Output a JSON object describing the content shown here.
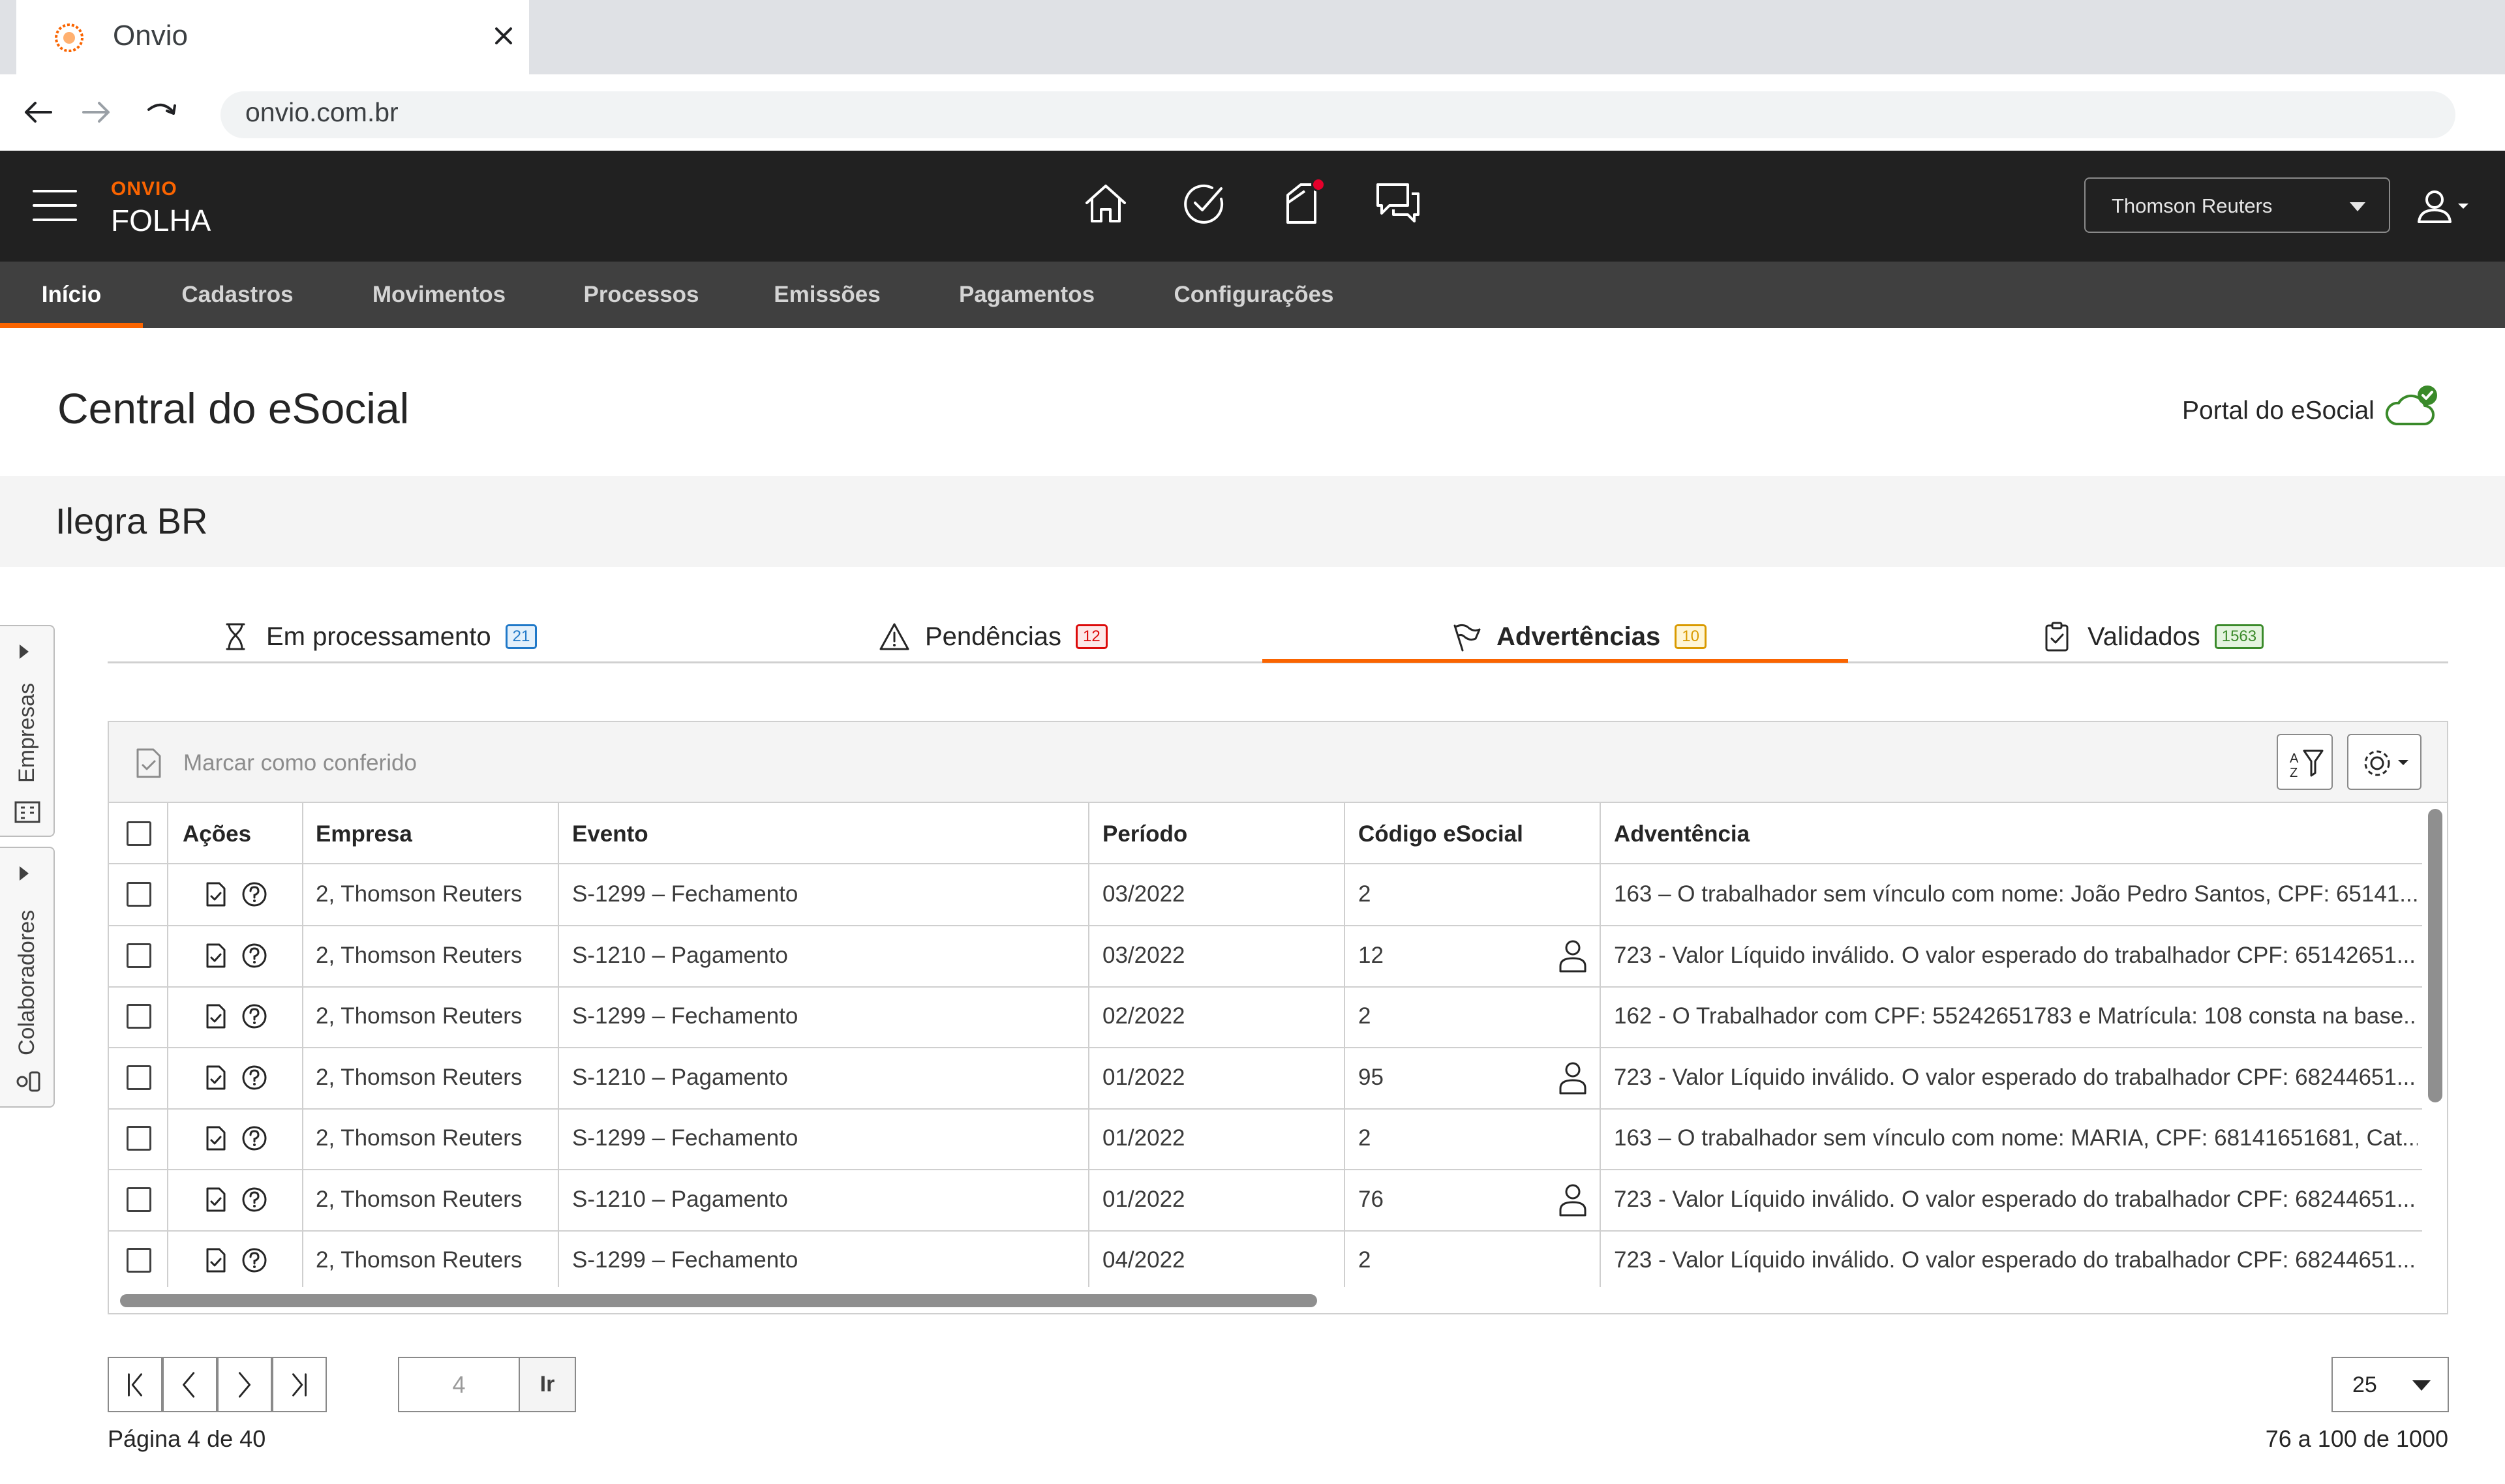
{
  "browser": {
    "tab_title": "Onvio",
    "url": "onvio.com.br"
  },
  "app": {
    "brand_small": "ONVIO",
    "brand_big": "FOLHA",
    "company_selector": "Thomson Reuters",
    "has_notification": true
  },
  "menu": {
    "items": [
      {
        "label": "Início",
        "active": true
      },
      {
        "label": "Cadastros"
      },
      {
        "label": "Movimentos"
      },
      {
        "label": "Processos"
      },
      {
        "label": "Emissões"
      },
      {
        "label": "Pagamentos"
      },
      {
        "label": "Configurações"
      }
    ]
  },
  "page": {
    "title": "Central do eSocial",
    "portal_label": "Portal do eSocial",
    "company_name": "Ilegra BR"
  },
  "side_rails": {
    "empresas": "Empresas",
    "colaboradores": "Colaboradores"
  },
  "status_tabs": [
    {
      "label": "Em processamento",
      "count": "21",
      "color": "#1f78c8",
      "bg": "#e3f0fb"
    },
    {
      "label": "Pendências",
      "count": "12",
      "color": "#dc0a0a",
      "bg": "#fde8e8"
    },
    {
      "label": "Advertências",
      "count": "10",
      "color": "#d99a00",
      "bg": "#fff6d6",
      "active": true
    },
    {
      "label": "Validados",
      "count": "1563",
      "color": "#3a8a2a",
      "bg": "#e4f4df"
    }
  ],
  "grid": {
    "mark_checked_label": "Marcar como conferido",
    "columns": [
      "Ações",
      "Empresa",
      "Evento",
      "Período",
      "Código eSocial",
      "Adventência"
    ],
    "rows": [
      {
        "empresa": "2, Thomson Reuters",
        "evento": "S-1299 – Fechamento",
        "periodo": "03/2022",
        "codigo": "2",
        "person": false,
        "adv": "163 – O trabalhador sem vínculo com nome: João Pedro Santos, CPF: 65141..."
      },
      {
        "empresa": "2, Thomson Reuters",
        "evento": "S-1210 – Pagamento",
        "periodo": "03/2022",
        "codigo": "12",
        "person": true,
        "adv": "723 - Valor Líquido inválido. O valor esperado do trabalhador CPF: 65142651..."
      },
      {
        "empresa": "2, Thomson Reuters",
        "evento": "S-1299 – Fechamento",
        "periodo": "02/2022",
        "codigo": "2",
        "person": false,
        "adv": "162 - O Trabalhador com CPF: 55242651783 e Matrícula: 108 consta na base..."
      },
      {
        "empresa": "2, Thomson Reuters",
        "evento": "S-1210 – Pagamento",
        "periodo": "01/2022",
        "codigo": "95",
        "person": true,
        "adv": "723 - Valor Líquido inválido. O valor esperado do trabalhador CPF: 68244651..."
      },
      {
        "empresa": "2, Thomson Reuters",
        "evento": "S-1299 – Fechamento",
        "periodo": "01/2022",
        "codigo": "2",
        "person": false,
        "adv": "163 – O trabalhador sem vínculo com nome: MARIA, CPF: 68141651681, Cat..."
      },
      {
        "empresa": "2, Thomson Reuters",
        "evento": "S-1210 – Pagamento",
        "periodo": "01/2022",
        "codigo": "76",
        "person": true,
        "adv": "723 - Valor Líquido inválido. O valor esperado do trabalhador CPF: 68244651..."
      },
      {
        "empresa": "2, Thomson Reuters",
        "evento": "S-1299 – Fechamento",
        "periodo": "04/2022",
        "codigo": "2",
        "person": false,
        "adv": "723 - Valor Líquido inválido. O valor esperado do trabalhador CPF: 68244651..."
      }
    ]
  },
  "pagination": {
    "page_input": "4",
    "go_label": "Ir",
    "page_info": "Página 4 de 40",
    "page_size": "25",
    "range_info": "76 a 100 de 1000"
  }
}
